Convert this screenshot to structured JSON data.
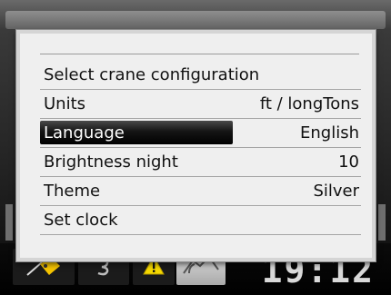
{
  "menu": {
    "items": [
      {
        "label": "Select crane configuration",
        "value": ""
      },
      {
        "label": "Units",
        "value": "ft / longTons"
      },
      {
        "label": "Language",
        "value": "English",
        "selected": true
      },
      {
        "label": "Brightness night",
        "value": "10"
      },
      {
        "label": "Theme",
        "value": "Silver"
      },
      {
        "label": "Set clock",
        "value": ""
      }
    ]
  },
  "status_bar": {
    "clock": "19:12",
    "icons": [
      "hook-tag-icon",
      "rotation-icon",
      "warning-icon",
      "crane-boom-icon"
    ]
  },
  "colors": {
    "dialog_bg": "#efefef",
    "highlight": "#000000",
    "warning": "#f5d800",
    "accent_yellow": "#f5c400"
  }
}
